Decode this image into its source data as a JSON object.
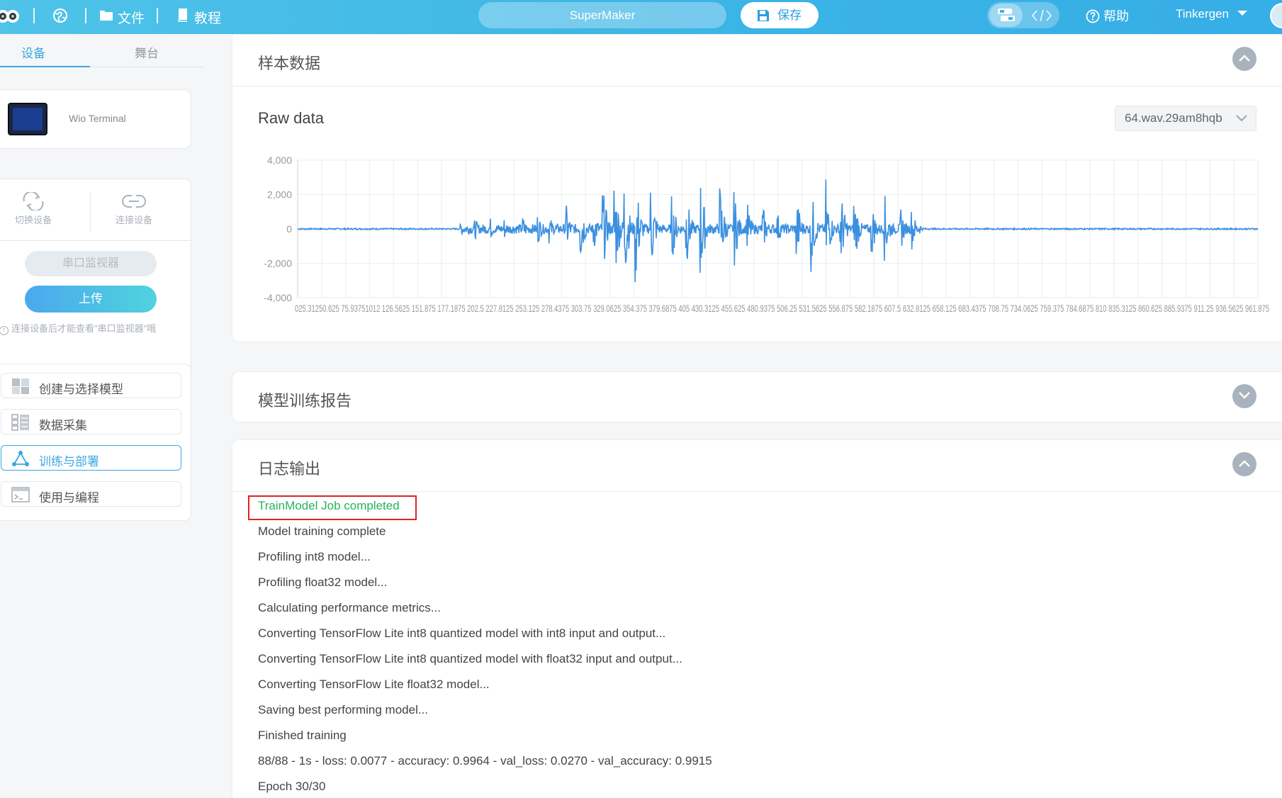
{
  "topbar": {
    "file_label": "文件",
    "tutorial_label": "教程",
    "project_name": "SuperMaker",
    "save_label": "保存",
    "help_label": "帮助",
    "user_name": "Tinkergen"
  },
  "sidebar": {
    "tabs": [
      {
        "label": "设备",
        "active": true
      },
      {
        "label": "舞台",
        "active": false
      }
    ],
    "device_name": "Wio Terminal",
    "actions": {
      "switch_device": "切换设备",
      "connect_device": "连接设备"
    },
    "serial_monitor_label": "串口监视器",
    "upload_label": "上传",
    "hint": "连接设备后才能查看\"串口监视器\"哦",
    "nav": [
      {
        "label": "创建与选择模型",
        "icon": "grid-icon",
        "active": false
      },
      {
        "label": "数据采集",
        "icon": "data-list-icon",
        "active": false
      },
      {
        "label": "训练与部署",
        "icon": "network-icon",
        "active": true
      },
      {
        "label": "使用与编程",
        "icon": "terminal-icon",
        "active": false
      }
    ]
  },
  "sample_panel": {
    "title": "样本数据",
    "raw_title": "Raw data",
    "selected_sample": "64.wav.29am8hqb"
  },
  "chart_data": {
    "type": "line",
    "title": "",
    "xlabel": "",
    "ylabel": "",
    "ylim": [
      -4000,
      4000
    ],
    "y_ticks": [
      "4,000",
      "2,000",
      "0",
      "-2,000",
      "-4,000"
    ],
    "x_tick_labels": "025.3125 50.625 75.9375 101.25 126.5625 151.875 177.1875 202.5 227.8125 253.125 278.4375 303.75 329.0625 354.375 379.6875 405 430.3125 455.625 480.9375 506.25 531.5625 556.875 582.1875 607.5 632.8125 658.125 683.4375 708.75 734.0625 759.375 784.6875 810 835.3125 860.625 885.9375 911.25 936.5625 961.875",
    "x_tick_display": "025.31250.625 75.93751012 126.5625 151.875 177.1875 202.5 227.8125 253.125 278.4375 303.75 329.0625 354.375 379.6875 405 430.3125 455.625 480.9375 506.25 531.5625 556.875 582.1875 607.5 632.8125 658.125 683.4375 708.75 734.0625 759.375 784.6875 810 835.3125 860.625 885.9375 911.25 936.5625 961.875",
    "xlim": [
      0,
      1000
    ],
    "series_color": "#3b8fe0",
    "bursts": [
      {
        "x": 170,
        "amp": 500
      },
      {
        "x": 185,
        "amp": 650
      },
      {
        "x": 200,
        "amp": 800
      },
      {
        "x": 215,
        "amp": 700
      },
      {
        "x": 235,
        "amp": 750
      },
      {
        "x": 250,
        "amp": 1000
      },
      {
        "x": 262,
        "amp": 900
      },
      {
        "x": 280,
        "amp": 1400
      },
      {
        "x": 295,
        "amp": 1900
      },
      {
        "x": 308,
        "amp": 1500
      },
      {
        "x": 318,
        "amp": 2600
      },
      {
        "x": 330,
        "amp": 3700
      },
      {
        "x": 340,
        "amp": 3900
      },
      {
        "x": 352,
        "amp": 3600
      },
      {
        "x": 368,
        "amp": 2900
      },
      {
        "x": 390,
        "amp": 2000
      },
      {
        "x": 405,
        "amp": 2300
      },
      {
        "x": 420,
        "amp": 3200
      },
      {
        "x": 440,
        "amp": 2800
      },
      {
        "x": 455,
        "amp": 2200
      },
      {
        "x": 468,
        "amp": 1700
      },
      {
        "x": 485,
        "amp": 1300
      },
      {
        "x": 500,
        "amp": 1000
      },
      {
        "x": 520,
        "amp": 2000
      },
      {
        "x": 535,
        "amp": 2600
      },
      {
        "x": 550,
        "amp": 3200
      },
      {
        "x": 565,
        "amp": 2900
      },
      {
        "x": 580,
        "amp": 2200
      },
      {
        "x": 598,
        "amp": 1700
      },
      {
        "x": 612,
        "amp": 2000
      },
      {
        "x": 628,
        "amp": 1400
      },
      {
        "x": 640,
        "amp": 1200
      }
    ]
  },
  "training_report_panel": {
    "title": "模型训练报告"
  },
  "log_panel": {
    "title": "日志输出",
    "lines": [
      "TrainModel Job completed",
      "Model training complete",
      "Profiling int8 model...",
      "Profiling float32 model...",
      "Calculating performance metrics...",
      "Converting TensorFlow Lite int8 quantized model with int8 input and output...",
      "Converting TensorFlow Lite int8 quantized model with float32 input and output...",
      "Converting TensorFlow Lite float32 model...",
      "Saving best performing model...",
      "Finished training",
      "88/88 - 1s - loss: 0.0077 - accuracy: 0.9964 - val_loss: 0.0270 - val_accuracy: 0.9915",
      "Epoch 30/30"
    ]
  }
}
